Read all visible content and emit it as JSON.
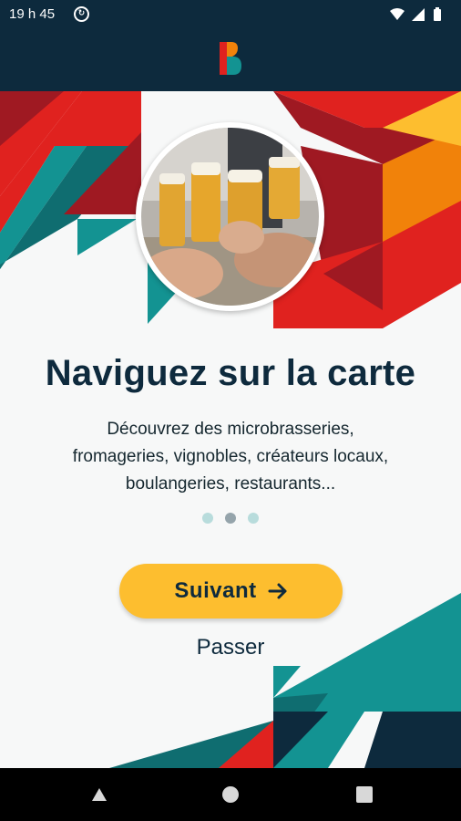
{
  "status_bar": {
    "time": "19 h 45",
    "sync_glyph": "↻"
  },
  "header": {
    "logo_icon": "brand-b-logo-icon"
  },
  "colors": {
    "dark_navy": "#0d2a3d",
    "teal": "#139392",
    "red": "#e0221f",
    "dark_red": "#9f1922",
    "orange": "#f1820a",
    "yellow": "#fdbe2f",
    "button_yellow": "#fdbe2f"
  },
  "onboarding": {
    "title": "Naviguez sur la carte",
    "description": "Découvrez des microbrasseries,\nfromageries, vignobles, créateurs locaux,\nboulangeries, restaurants...",
    "page_indicator": {
      "current": 2,
      "total": 3
    },
    "next_label": "Suivant",
    "next_icon": "arrow-right-icon",
    "skip_label": "Passer"
  },
  "nav_bar": {
    "back_icon": "back-triangle-icon",
    "home_icon": "home-circle-icon",
    "recents_icon": "recents-square-icon"
  }
}
